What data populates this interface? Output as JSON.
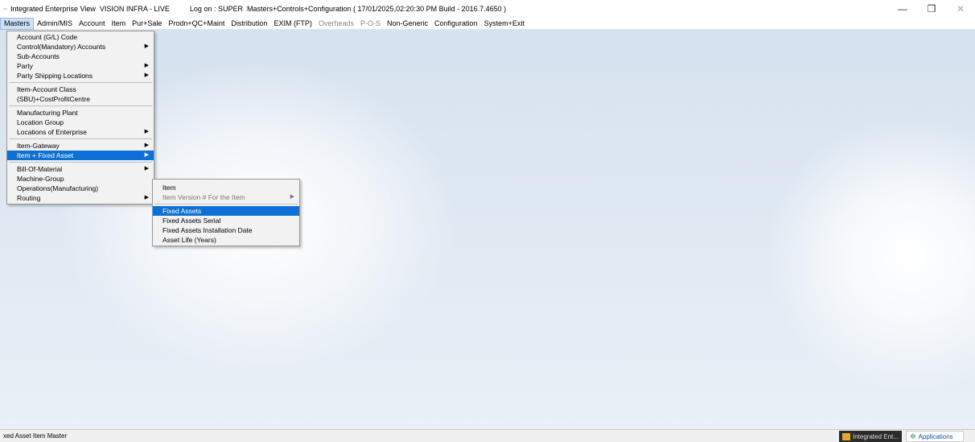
{
  "window": {
    "title": "Integrated Enterprise View  VISION INFRA - LIVE          Log on : SUPER  Masters+Controls+Configuration ( 17/01/2025,02:20:30 PM Build - 2016.7.4650 )",
    "controls": {
      "minimize": "—",
      "maximize": "❐",
      "close": "✕"
    }
  },
  "menubar": {
    "items": [
      "Masters",
      "Admin/MIS",
      "Account",
      "Item",
      "Pur+Sale",
      "Prodn+QC+Maint",
      "Distribution",
      "EXIM (FTP)",
      "Overheads",
      "P-O-S",
      "Non-Generic",
      "Configuration",
      "System+Exit"
    ]
  },
  "masters_menu": {
    "g1": [
      "Account (G/L) Code",
      "Control(Mandatory) Accounts",
      "Sub-Accounts",
      "Party",
      "Party Shipping Locations"
    ],
    "g2": [
      "Item-Account Class",
      "(SBU)+CostProfitCentre"
    ],
    "g3": [
      "Manufacturing Plant",
      "Location Group",
      "Locations of Enterprise"
    ],
    "g4": [
      "Item-Gateway",
      "Item + Fixed Asset"
    ],
    "g5": [
      "Bill-Of-Material",
      "Machine-Group",
      "Operations(Manufacturing)",
      "Routing"
    ]
  },
  "submenu": {
    "g1": [
      "Item",
      "Item Version #  For  the Item"
    ],
    "g2": [
      "Fixed Assets",
      "Fixed Assets Serial",
      "Fixed Assets Installation Date",
      "Asset Life  (Years)"
    ]
  },
  "statusbar": {
    "text": "xed  Asset Item Master",
    "task1": "Integrated Ent...",
    "task2": "Applications"
  }
}
